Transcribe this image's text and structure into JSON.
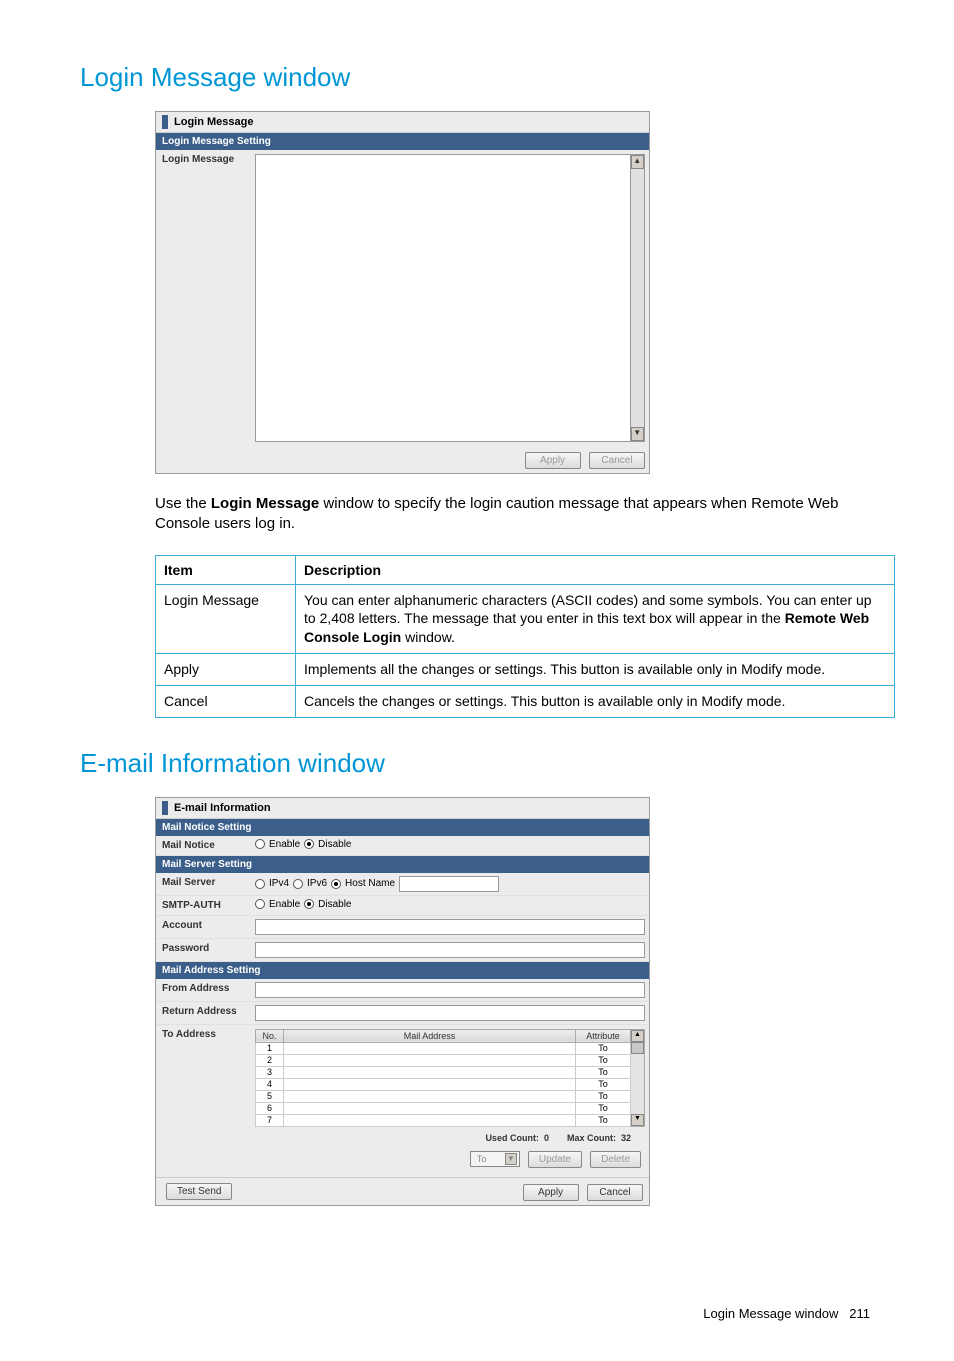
{
  "headings": {
    "login_message_window": "Login Message window",
    "email_info_window": "E-mail Information window"
  },
  "login_panel": {
    "title": "Login Message",
    "section": "Login Message Setting",
    "label": "Login Message",
    "apply": "Apply",
    "cancel": "Cancel"
  },
  "intro": {
    "pre": "Use the ",
    "strong": "Login Message",
    "post": " window to specify the login caution message that appears when Remote Web Console users log in."
  },
  "desc_table": {
    "headers": {
      "item": "Item",
      "description": "Description"
    },
    "rows": [
      {
        "item": "Login Message",
        "desc_pre": "You can enter alphanumeric characters (ASCII codes) and some symbols. You can enter up to 2,408 letters. The message that you enter in this text box will appear in the ",
        "desc_strong": "Remote Web Console Login",
        "desc_post": " window."
      },
      {
        "item": "Apply",
        "desc_pre": "Implements all the changes or settings. This button is available only in Modify mode.",
        "desc_strong": "",
        "desc_post": ""
      },
      {
        "item": "Cancel",
        "desc_pre": "Cancels the changes or settings. This button is available only in Modify mode.",
        "desc_strong": "",
        "desc_post": ""
      }
    ]
  },
  "email_panel": {
    "title": "E-mail Information",
    "sections": {
      "notice": "Mail Notice Setting",
      "server": "Mail Server Setting",
      "address": "Mail Address Setting"
    },
    "labels": {
      "mail_notice": "Mail Notice",
      "mail_server": "Mail Server",
      "smtp_auth": "SMTP-AUTH",
      "account": "Account",
      "password": "Password",
      "from_addr": "From Address",
      "return_addr": "Return Address",
      "to_addr": "To Address"
    },
    "radios": {
      "enable": "Enable",
      "disable": "Disable",
      "ipv4": "IPv4",
      "ipv6": "IPv6",
      "hostname": "Host Name"
    },
    "mail_table": {
      "headers": {
        "no": "No.",
        "addr": "Mail Address",
        "attr": "Attribute"
      },
      "rows": [
        {
          "no": "1",
          "addr": "",
          "attr": "To"
        },
        {
          "no": "2",
          "addr": "",
          "attr": "To"
        },
        {
          "no": "3",
          "addr": "",
          "attr": "To"
        },
        {
          "no": "4",
          "addr": "",
          "attr": "To"
        },
        {
          "no": "5",
          "addr": "",
          "attr": "To"
        },
        {
          "no": "6",
          "addr": "",
          "attr": "To"
        },
        {
          "no": "7",
          "addr": "",
          "attr": "To"
        }
      ],
      "used_count_label": "Used Count:",
      "used_count": "0",
      "max_count_label": "Max Count:",
      "max_count": "32"
    },
    "controls": {
      "attr_select": "To",
      "update": "Update",
      "delete": "Delete"
    },
    "bottom": {
      "test_send": "Test Send",
      "apply": "Apply",
      "cancel": "Cancel"
    }
  },
  "footer": {
    "text": "Login Message window",
    "page": "211"
  }
}
